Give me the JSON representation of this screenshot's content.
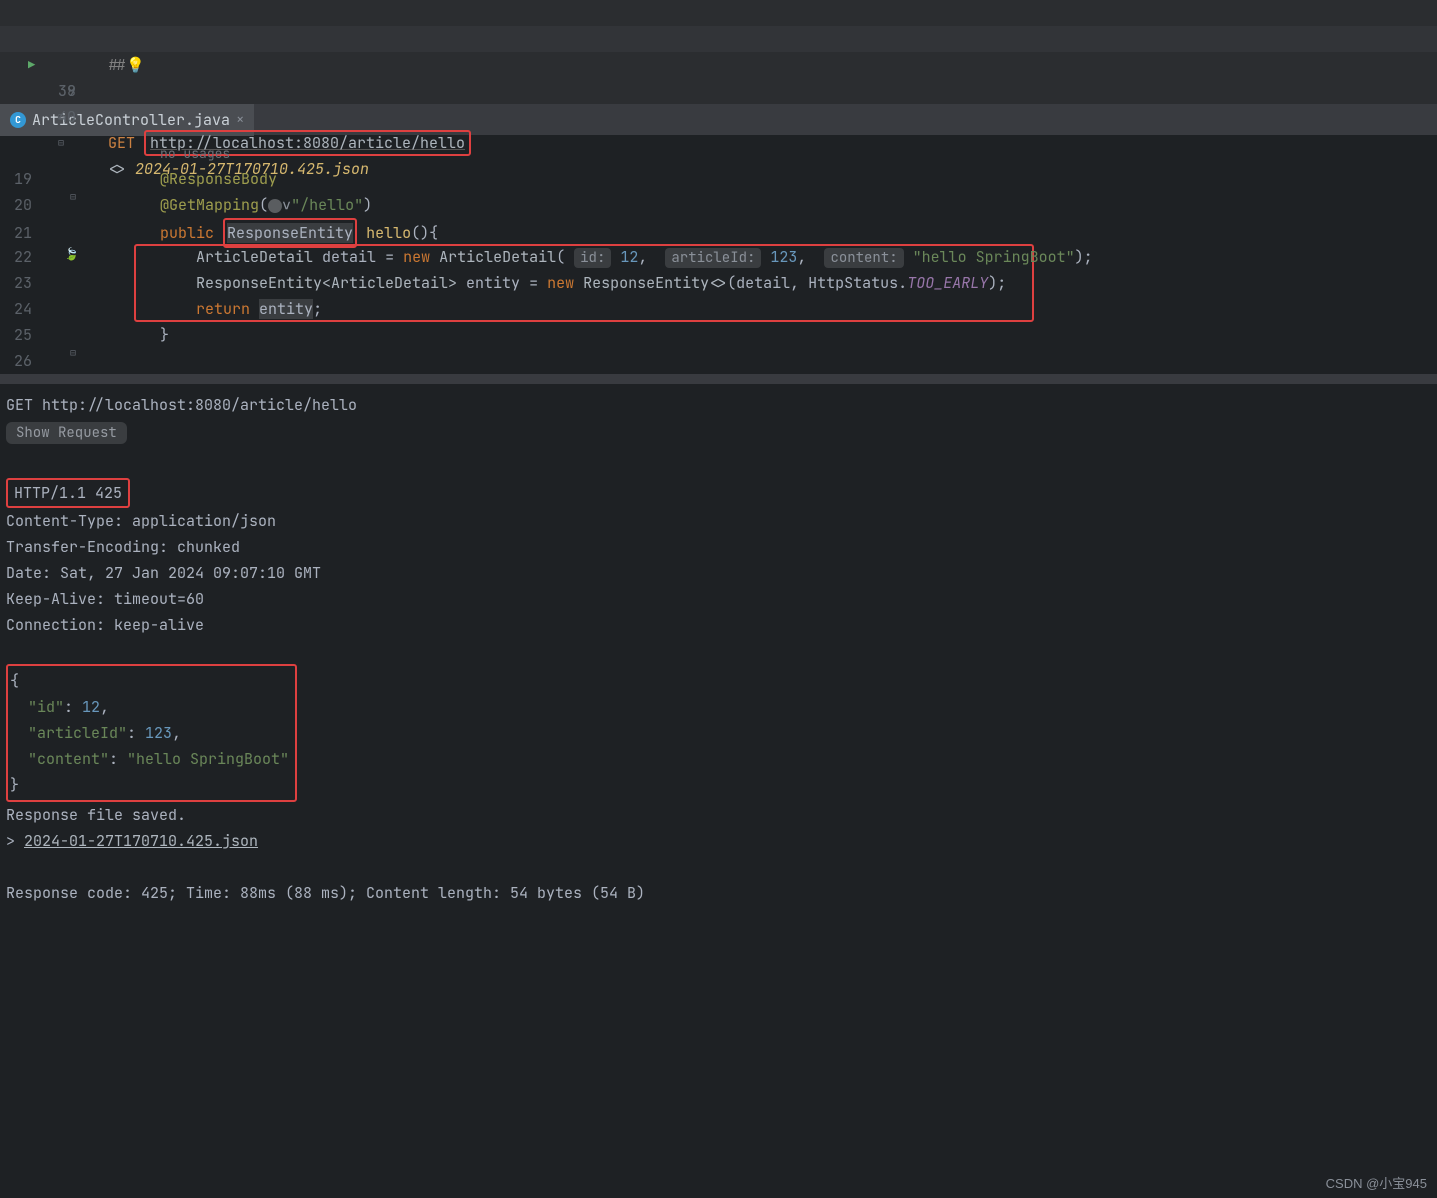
{
  "top_editor": {
    "lines": {
      "37": "##",
      "38_method": "GET",
      "38_url": "http://localhost:8080/article/hello",
      "40_file": "2024-01-27T170710.425.json"
    }
  },
  "tab": {
    "icon_letter": "C",
    "filename": "ArticleController.java"
  },
  "code": {
    "usages": "no usages",
    "l19_annotation": "@ResponseBody",
    "l20_annotation": "@GetMapping",
    "l20_path": "\"/hello\"",
    "l21_public": "public",
    "l21_type": "ResponseEntity",
    "l21_method": "hello",
    "l22_type1": "ArticleDetail",
    "l22_var": "detail",
    "l22_new": "new",
    "l22_type2": "ArticleDetail",
    "l22_hint1": "id:",
    "l22_val1": "12",
    "l22_hint2": "articleId:",
    "l22_val2": "123",
    "l22_hint3": "content:",
    "l22_val3": "\"hello SpringBoot\"",
    "l23_type": "ResponseEntity<ArticleDetail>",
    "l23_var": "entity",
    "l23_new": "new",
    "l23_ctor": "ResponseEntity<>",
    "l23_arg1": "detail",
    "l23_arg2": "HttpStatus.",
    "l23_const": "TOO_EARLY",
    "l24_return": "return",
    "l24_var": "entity"
  },
  "response": {
    "request_line": "GET http://localhost:8080/article/hello",
    "show_request": "Show Request",
    "status_line": "HTTP/1.1 425",
    "headers": {
      "content_type": "Content-Type: application/json",
      "transfer_encoding": "Transfer-Encoding: chunked",
      "date": "Date: Sat, 27 Jan 2024 09:07:10 GMT",
      "keep_alive": "Keep-Alive: timeout=60",
      "connection": "Connection: keep-alive"
    },
    "body": {
      "id_key": "\"id\"",
      "id_val": "12",
      "articleId_key": "\"articleId\"",
      "articleId_val": "123",
      "content_key": "\"content\"",
      "content_val": "\"hello SpringBoot\""
    },
    "saved_msg": "Response file saved.",
    "saved_file": "2024-01-27T170710.425.json",
    "summary": "Response code: 425; Time: 88ms (88 ms); Content length: 54 bytes (54 B)"
  },
  "watermark": "CSDN @小宝945"
}
